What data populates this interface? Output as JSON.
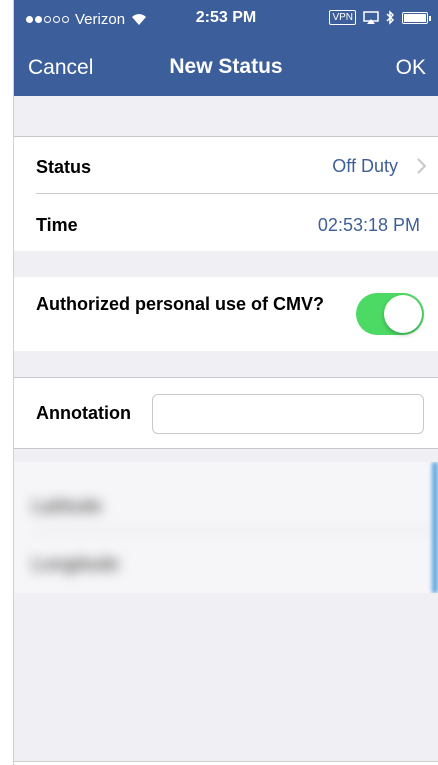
{
  "status_bar": {
    "carrier": "Verizon",
    "time": "2:53 PM",
    "vpn": "VPN"
  },
  "nav": {
    "cancel": "Cancel",
    "title": "New Status",
    "ok": "OK"
  },
  "rows": {
    "status_label": "Status",
    "status_value": "Off Duty",
    "time_label": "Time",
    "time_value": "02:53:18 PM"
  },
  "personal_use": {
    "label": "Authorized personal use of CMV?",
    "on": true
  },
  "annotation": {
    "label": "Annotation",
    "value": ""
  },
  "blurred": {
    "latitude": "Latitude",
    "longitude": "Longitude"
  },
  "colors": {
    "nav_bg": "#3c5f9c",
    "value_blue": "#3f5f98",
    "toggle_green": "#4cd964",
    "grouped_bg": "#efeff4"
  },
  "icons": [
    "signal-dots-icon",
    "wifi-icon",
    "vpn-badge",
    "airplay-icon",
    "bluetooth-icon",
    "battery-icon",
    "chevron-right-icon"
  ]
}
